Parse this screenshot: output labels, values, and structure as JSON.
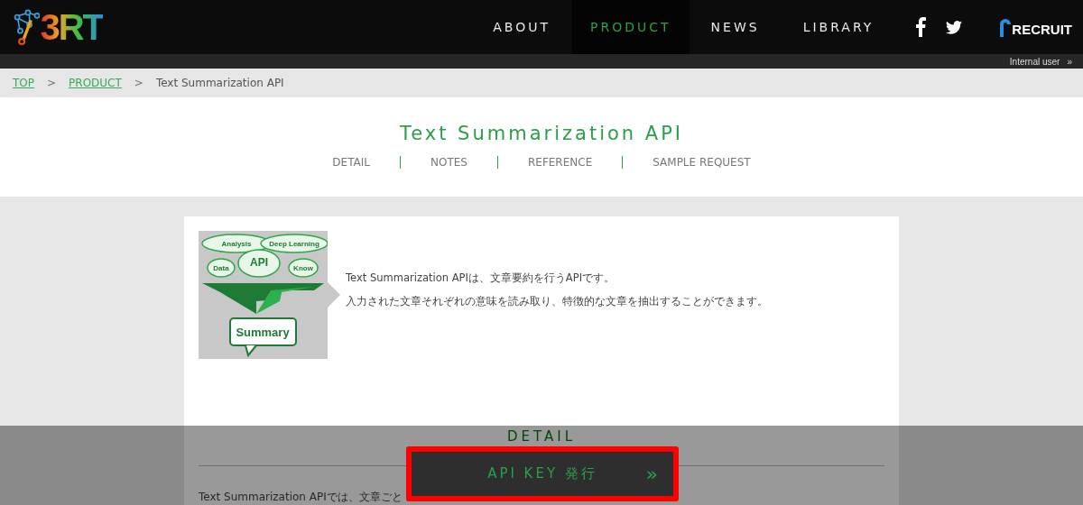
{
  "header": {
    "logo_text": "3RT",
    "nav": [
      {
        "label": "ABOUT",
        "selected": false
      },
      {
        "label": "PRODUCT",
        "selected": true
      },
      {
        "label": "NEWS",
        "selected": false
      },
      {
        "label": "LIBRARY",
        "selected": false
      }
    ],
    "company_logo_text": "RECRUIT"
  },
  "subbar": {
    "link": "Internal user",
    "link_icon": "»"
  },
  "breadcrumb": [
    {
      "label": "TOP",
      "link": true
    },
    {
      "label": "PRODUCT",
      "link": true
    },
    {
      "label": "Text Summarization API",
      "link": false
    }
  ],
  "breadcrumb_separator": ">",
  "page_title": "Text Summarization API",
  "subnav": [
    "DETAIL",
    "NOTES",
    "REFERENCE",
    "SAMPLE REQUEST"
  ],
  "illustration": {
    "bubbles": [
      "Analysis",
      "Deep Learning",
      "Data",
      "API",
      "Know"
    ],
    "result": "Summary"
  },
  "intro": [
    "Text Summarization APIは、文章要約を行うAPIです。",
    "入力された文章それぞれの意味を読み取り、特徴的な文章を抽出することができます。"
  ],
  "section_heading": "DETAIL",
  "section_text": "Text Summarization APIでは、文章ごと",
  "overlay_button": {
    "label": "API KEY 発行",
    "icon": "»"
  }
}
